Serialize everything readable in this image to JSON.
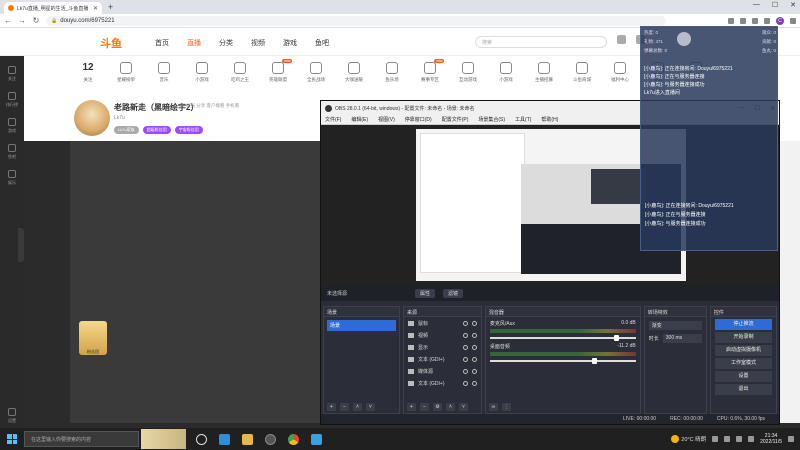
{
  "browser": {
    "tab_title": "Lk7u直播_明星的生活_斗鱼直播",
    "url": "douyu.com/6975221",
    "profile_initial": "C"
  },
  "site": {
    "logo": "斗鱼",
    "nav": [
      "首页",
      "直播",
      "分类",
      "视频",
      "游戏",
      "鱼吧"
    ],
    "search_placeholder": "搜索",
    "sidebar": [
      "关注",
      "排行榜",
      "游戏",
      "鱼吧",
      "娱乐"
    ],
    "sidebar_bottom": "设置",
    "categories": [
      {
        "label": "12",
        "type": "count"
      },
      {
        "label": "星耀榜单",
        "badge": ""
      },
      {
        "label": "音乐"
      },
      {
        "label": "小游戏"
      },
      {
        "label": "吃鸡之王"
      },
      {
        "label": "英雄联盟",
        "badge": "new"
      },
      {
        "label": "全民战场"
      },
      {
        "label": "大咖送暖"
      },
      {
        "label": "鱼乐场"
      },
      {
        "label": "赛事专区",
        "badge": "new"
      },
      {
        "label": "互动游戏"
      },
      {
        "label": "小游戏"
      },
      {
        "label": "主播招募"
      },
      {
        "label": "斗鱼商城"
      },
      {
        "label": "福利中心"
      },
      {
        "label": "签到"
      },
      {
        "label": "更多"
      }
    ],
    "room": {
      "title": "老路新走（黑暗绘宇2）",
      "meta": "举报  分享  客户端看  手机看",
      "host": "Lk7u",
      "tags": [
        "Lk7u家族",
        "超级粉丝团",
        "宇宙粉丝团"
      ]
    },
    "gift_label": "粉丝团"
  },
  "obs": {
    "title": "OBS 28.0.1 (64-bit, windows) - 配置文件: 未命名 - 场景: 未命名",
    "window_controls": [
      "—",
      "☐",
      "✕"
    ],
    "menu": [
      "文件(F)",
      "编辑(E)",
      "视图(V)",
      "停靠窗口(D)",
      "配置文件(P)",
      "场景集合(S)",
      "工具(T)",
      "帮助(H)"
    ],
    "srcbar_label": "未选择源",
    "srcbar_buttons": [
      "属性",
      "滤镜"
    ],
    "docks": {
      "scenes": {
        "title": "场景",
        "items": [
          "场景"
        ]
      },
      "sources": {
        "title": "来源",
        "items": [
          "鼠标",
          "视频",
          "显示",
          "文本 (GDI+)",
          "媒体源",
          "文本 (GDI+)"
        ]
      },
      "mixer": {
        "title": "混音器",
        "channels": [
          {
            "name": "麦克风/Aux",
            "db": "0.0 dB",
            "level": 0.85
          },
          {
            "name": "桌面音频",
            "db": "-11.2 dB",
            "level": 0.7
          }
        ]
      },
      "transitions": {
        "title": "转场特效",
        "type": "渐变",
        "duration_label": "时长",
        "duration": "300 ms"
      },
      "controls": {
        "title": "控件",
        "buttons": [
          "停止推流",
          "开始录制",
          "启动虚拟摄像机",
          "工作室模式",
          "设置",
          "退出"
        ]
      }
    },
    "status": {
      "live": "LIVE: 00:00:00",
      "rec": "REC: 00:00:00",
      "cpu": "CPU: 0.6%, 30.00 fps"
    }
  },
  "overlay": {
    "stats": [
      {
        "label": "热度:",
        "value": "0"
      },
      {
        "label": "礼物:",
        "value": "471"
      },
      {
        "label": "弹幕总数:",
        "value": "0"
      },
      {
        "label": "观众:",
        "value": "0"
      },
      {
        "label": "贡献:",
        "value": "0"
      },
      {
        "label": "鱼丸:",
        "value": "0"
      }
    ],
    "messages": [
      "[小鹿鸟]: 正在连接房间: Douyu/6975221",
      "[小鹿鸟]: 正在与服务器连接",
      "[小鹿鸟]: 与服务器连接成功",
      "Lk7u进入直播间"
    ],
    "messages2": [
      "[小鹿鸟]: 正在连接房间: Douyu/6975221",
      "[小鹿鸟]: 正在与服务器连接",
      "[小鹿鸟]: 与服务器连接成功"
    ]
  },
  "taskbar": {
    "search_placeholder": "在这里输入你要搜索的内容",
    "weather": "20°C 晴朗",
    "time": "21:34",
    "date": "2022/11/5"
  },
  "colors": {
    "accent": "#ff5d23",
    "obs_blue": "#2e6bd6",
    "douyu_orange": "#ff7a00"
  }
}
